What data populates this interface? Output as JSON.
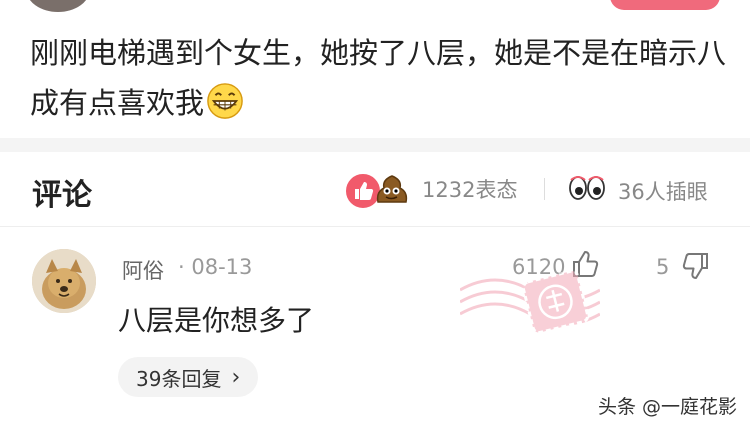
{
  "post": {
    "text": "刚刚电梯遇到个女生，她按了八层，她是不是在暗示八成有点喜欢我",
    "emoji": "grinning-face-icon"
  },
  "comments_header": {
    "title": "评论",
    "reactions_count": "1232表态",
    "watch_count": "36人插眼"
  },
  "comment": {
    "user": "阿俗",
    "date": "· 08-13",
    "likes": "6120",
    "dislikes": "5",
    "text": "八层是你想多了",
    "replies": "39条回复"
  },
  "watermark": "头条 @一庭花影",
  "colors": {
    "accent_pink": "#f15a6b",
    "stamp_pink": "#f2a2b2",
    "text_dark": "#222222",
    "text_muted": "#999999"
  }
}
